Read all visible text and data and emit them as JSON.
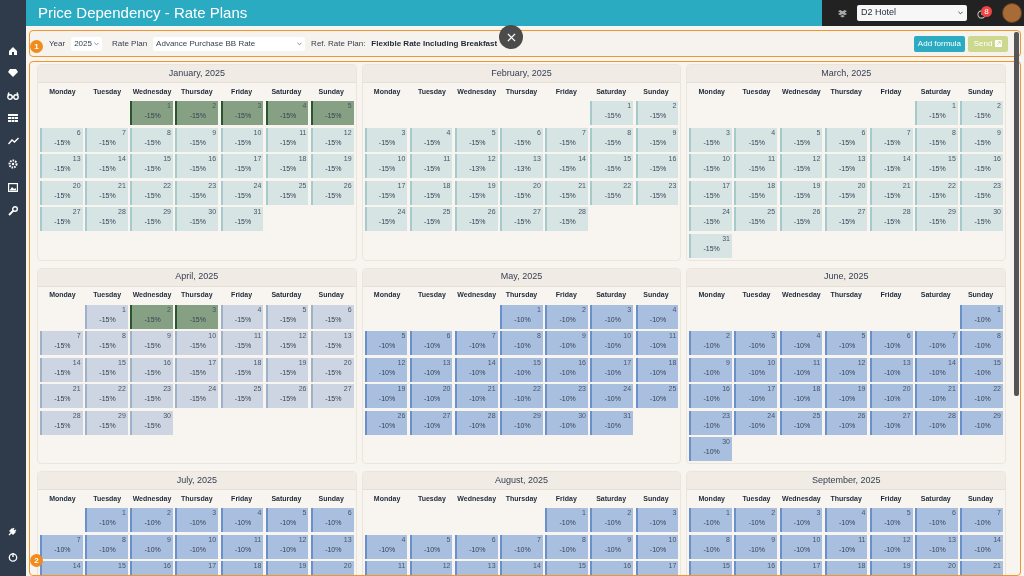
{
  "header": {
    "title": "Price Dependency - Rate Plans",
    "hotel": "D2 Hotel",
    "notification_count": "8"
  },
  "filters": {
    "year_label": "Year",
    "year": "2025",
    "rate_plan_label": "Rate Plan",
    "rate_plan": "Advance Purchase BB Rate",
    "ref_label": "Ref. Rate Plan:",
    "ref_value": "Flexible Rate Including Breakfast",
    "buttons": [
      {
        "label": "Add formula",
        "disabled": false,
        "kind": "formula"
      },
      {
        "label": "Send",
        "disabled": true,
        "kind": "send"
      }
    ]
  },
  "annotations": [
    "1",
    "2"
  ],
  "months": [
    {
      "title": "January, 2025",
      "kind": "teal",
      "weekdays": [
        "Monday",
        "Tuesday",
        "Wednesday",
        "Thursday",
        "Friday",
        "Saturday",
        "Sunday"
      ],
      "weeks": [
        [
          {
            "kind": "empty"
          },
          {
            "kind": "empty"
          },
          {
            "day": "1",
            "value": "-15%",
            "selected": true
          },
          {
            "day": "2",
            "value": "-15%",
            "selected": true
          },
          {
            "day": "3",
            "value": "-15%",
            "selected": true
          },
          {
            "day": "4",
            "value": "-15%",
            "selected": true
          },
          {
            "day": "5",
            "value": "-15%",
            "selected": true
          }
        ],
        [
          {
            "day": "6",
            "value": "-15%",
            "selected": false
          },
          {
            "day": "7",
            "value": "-15%",
            "selected": false
          },
          {
            "day": "8",
            "value": "-15%",
            "selected": false
          },
          {
            "day": "9",
            "value": "-15%",
            "selected": false
          },
          {
            "day": "10",
            "value": "-15%",
            "selected": false
          },
          {
            "day": "11",
            "value": "-15%",
            "selected": false
          },
          {
            "day": "12",
            "value": "-15%",
            "selected": false
          }
        ],
        [
          {
            "day": "13",
            "value": "-15%",
            "selected": false
          },
          {
            "day": "14",
            "value": "-15%",
            "selected": false
          },
          {
            "day": "15",
            "value": "-15%",
            "selected": false
          },
          {
            "day": "16",
            "value": "-15%",
            "selected": false
          },
          {
            "day": "17",
            "value": "-15%",
            "selected": false
          },
          {
            "day": "18",
            "value": "-15%",
            "selected": false
          },
          {
            "day": "19",
            "value": "-15%",
            "selected": false
          }
        ],
        [
          {
            "day": "20",
            "value": "-15%",
            "selected": false
          },
          {
            "day": "21",
            "value": "-15%",
            "selected": false
          },
          {
            "day": "22",
            "value": "-15%",
            "selected": false
          },
          {
            "day": "23",
            "value": "-15%",
            "selected": false
          },
          {
            "day": "24",
            "value": "-15%",
            "selected": false
          },
          {
            "day": "25",
            "value": "-15%",
            "selected": false
          },
          {
            "day": "26",
            "value": "-15%",
            "selected": false
          }
        ],
        [
          {
            "day": "27",
            "value": "-15%",
            "selected": false
          },
          {
            "day": "28",
            "value": "-15%",
            "selected": false
          },
          {
            "day": "29",
            "value": "-15%",
            "selected": false
          },
          {
            "day": "30",
            "value": "-15%",
            "selected": false
          },
          {
            "day": "31",
            "value": "-15%",
            "selected": false
          }
        ]
      ]
    },
    {
      "title": "February, 2025",
      "kind": "teal",
      "weekdays": [
        "Monday",
        "Tuesday",
        "Wednesday",
        "Thursday",
        "Friday",
        "Saturday",
        "Sunday"
      ],
      "weeks": [
        [
          {
            "kind": "empty"
          },
          {
            "kind": "empty"
          },
          {
            "kind": "empty"
          },
          {
            "kind": "empty"
          },
          {
            "kind": "empty"
          },
          {
            "day": "1",
            "value": "-15%",
            "selected": false
          },
          {
            "day": "2",
            "value": "-15%",
            "selected": false
          }
        ],
        [
          {
            "day": "3",
            "value": "-15%",
            "selected": false
          },
          {
            "day": "4",
            "value": "-15%",
            "selected": false
          },
          {
            "day": "5",
            "value": "-15%",
            "selected": false
          },
          {
            "day": "6",
            "value": "-15%",
            "selected": false
          },
          {
            "day": "7",
            "value": "-15%",
            "selected": false
          },
          {
            "day": "8",
            "value": "-15%",
            "selected": false
          },
          {
            "day": "9",
            "value": "-15%",
            "selected": false
          }
        ],
        [
          {
            "day": "10",
            "value": "-15%",
            "selected": false
          },
          {
            "day": "11",
            "value": "-15%",
            "selected": false
          },
          {
            "day": "12",
            "value": "-13%",
            "selected": false
          },
          {
            "day": "13",
            "value": "-13%",
            "selected": false
          },
          {
            "day": "14",
            "value": "-15%",
            "selected": false
          },
          {
            "day": "15",
            "value": "-15%",
            "selected": false
          },
          {
            "day": "16",
            "value": "-15%",
            "selected": false
          }
        ],
        [
          {
            "day": "17",
            "value": "-15%",
            "selected": false
          },
          {
            "day": "18",
            "value": "-15%",
            "selected": false
          },
          {
            "day": "19",
            "value": "-15%",
            "selected": false
          },
          {
            "day": "20",
            "value": "-15%",
            "selected": false
          },
          {
            "day": "21",
            "value": "-15%",
            "selected": false
          },
          {
            "day": "22",
            "value": "-15%",
            "selected": false
          },
          {
            "day": "23",
            "value": "-15%",
            "selected": false
          }
        ],
        [
          {
            "day": "24",
            "value": "-15%",
            "selected": false
          },
          {
            "day": "25",
            "value": "-15%",
            "selected": false
          },
          {
            "day": "26",
            "value": "-15%",
            "selected": false
          },
          {
            "day": "27",
            "value": "-15%",
            "selected": false
          },
          {
            "day": "28",
            "value": "-15%",
            "selected": false
          }
        ]
      ]
    },
    {
      "title": "March, 2025",
      "kind": "teal",
      "weekdays": [
        "Monday",
        "Tuesday",
        "Wednesday",
        "Thursday",
        "Friday",
        "Saturday",
        "Sunday"
      ],
      "weeks": [
        [
          {
            "kind": "empty"
          },
          {
            "kind": "empty"
          },
          {
            "kind": "empty"
          },
          {
            "kind": "empty"
          },
          {
            "kind": "empty"
          },
          {
            "day": "1",
            "value": "-15%",
            "selected": false
          },
          {
            "day": "2",
            "value": "-15%",
            "selected": false
          }
        ],
        [
          {
            "day": "3",
            "value": "-15%",
            "selected": false
          },
          {
            "day": "4",
            "value": "-15%",
            "selected": false
          },
          {
            "day": "5",
            "value": "-15%",
            "selected": false
          },
          {
            "day": "6",
            "value": "-15%",
            "selected": false
          },
          {
            "day": "7",
            "value": "-15%",
            "selected": false
          },
          {
            "day": "8",
            "value": "-15%",
            "selected": false
          },
          {
            "day": "9",
            "value": "-15%",
            "selected": false
          }
        ],
        [
          {
            "day": "10",
            "value": "-15%",
            "selected": false
          },
          {
            "day": "11",
            "value": "-15%",
            "selected": false
          },
          {
            "day": "12",
            "value": "-15%",
            "selected": false
          },
          {
            "day": "13",
            "value": "-15%",
            "selected": false
          },
          {
            "day": "14",
            "value": "-15%",
            "selected": false
          },
          {
            "day": "15",
            "value": "-15%",
            "selected": false
          },
          {
            "day": "16",
            "value": "-15%",
            "selected": false
          }
        ],
        [
          {
            "day": "17",
            "value": "-15%",
            "selected": false
          },
          {
            "day": "18",
            "value": "-15%",
            "selected": false
          },
          {
            "day": "19",
            "value": "-15%",
            "selected": false
          },
          {
            "day": "20",
            "value": "-15%",
            "selected": false
          },
          {
            "day": "21",
            "value": "-15%",
            "selected": false
          },
          {
            "day": "22",
            "value": "-15%",
            "selected": false
          },
          {
            "day": "23",
            "value": "-15%",
            "selected": false
          }
        ],
        [
          {
            "day": "24",
            "value": "-15%",
            "selected": false
          },
          {
            "day": "25",
            "value": "-15%",
            "selected": false
          },
          {
            "day": "26",
            "value": "-15%",
            "selected": false
          },
          {
            "day": "27",
            "value": "-15%",
            "selected": false
          },
          {
            "day": "28",
            "value": "-15%",
            "selected": false
          },
          {
            "day": "29",
            "value": "-15%",
            "selected": false
          },
          {
            "day": "30",
            "value": "-15%",
            "selected": false
          }
        ],
        [
          {
            "day": "31",
            "value": "-15%",
            "selected": false
          }
        ]
      ]
    },
    {
      "title": "April, 2025",
      "kind": "slate",
      "weekdays": [
        "Monday",
        "Tuesday",
        "Wednesday",
        "Thursday",
        "Friday",
        "Saturday",
        "Sunday"
      ],
      "weeks": [
        [
          {
            "kind": "empty"
          },
          {
            "day": "1",
            "value": "-15%",
            "selected": false
          },
          {
            "day": "2",
            "value": "-15%",
            "selected": true
          },
          {
            "day": "3",
            "value": "-15%",
            "selected": true
          },
          {
            "day": "4",
            "value": "-15%",
            "selected": false
          },
          {
            "day": "5",
            "value": "-15%",
            "selected": false
          },
          {
            "day": "6",
            "value": "-15%",
            "selected": false
          }
        ],
        [
          {
            "day": "7",
            "value": "-15%",
            "selected": false
          },
          {
            "day": "8",
            "value": "-15%",
            "selected": false
          },
          {
            "day": "9",
            "value": "-15%",
            "selected": false
          },
          {
            "day": "10",
            "value": "-15%",
            "selected": false
          },
          {
            "day": "11",
            "value": "-15%",
            "selected": false
          },
          {
            "day": "12",
            "value": "-15%",
            "selected": false
          },
          {
            "day": "13",
            "value": "-15%",
            "selected": false
          }
        ],
        [
          {
            "day": "14",
            "value": "-15%",
            "selected": false
          },
          {
            "day": "15",
            "value": "-15%",
            "selected": false
          },
          {
            "day": "16",
            "value": "-15%",
            "selected": false
          },
          {
            "day": "17",
            "value": "-15%",
            "selected": false
          },
          {
            "day": "18",
            "value": "-15%",
            "selected": false
          },
          {
            "day": "19",
            "value": "-15%",
            "selected": false
          },
          {
            "day": "20",
            "value": "-15%",
            "selected": false
          }
        ],
        [
          {
            "day": "21",
            "value": "-15%",
            "selected": false
          },
          {
            "day": "22",
            "value": "-15%",
            "selected": false
          },
          {
            "day": "23",
            "value": "-15%",
            "selected": false
          },
          {
            "day": "24",
            "value": "-15%",
            "selected": false
          },
          {
            "day": "25",
            "value": "-15%",
            "selected": false
          },
          {
            "day": "26",
            "value": "-15%",
            "selected": false
          },
          {
            "day": "27",
            "value": "-15%",
            "selected": false
          }
        ],
        [
          {
            "day": "28",
            "value": "-15%",
            "selected": false
          },
          {
            "day": "29",
            "value": "-15%",
            "selected": false
          },
          {
            "day": "30",
            "value": "-15%",
            "selected": false
          }
        ]
      ]
    },
    {
      "title": "May, 2025",
      "kind": "blue",
      "weekdays": [
        "Monday",
        "Tuesday",
        "Wednesday",
        "Thursday",
        "Friday",
        "Saturday",
        "Sunday"
      ],
      "weeks": [
        [
          {
            "kind": "empty"
          },
          {
            "kind": "empty"
          },
          {
            "kind": "empty"
          },
          {
            "day": "1",
            "value": "-10%",
            "selected": false
          },
          {
            "day": "2",
            "value": "-10%",
            "selected": false
          },
          {
            "day": "3",
            "value": "-10%",
            "selected": false
          },
          {
            "day": "4",
            "value": "-10%",
            "selected": false
          }
        ],
        [
          {
            "day": "5",
            "value": "-10%",
            "selected": false
          },
          {
            "day": "6",
            "value": "-10%",
            "selected": false
          },
          {
            "day": "7",
            "value": "-10%",
            "selected": false
          },
          {
            "day": "8",
            "value": "-10%",
            "selected": false
          },
          {
            "day": "9",
            "value": "-10%",
            "selected": false
          },
          {
            "day": "10",
            "value": "-10%",
            "selected": false
          },
          {
            "day": "11",
            "value": "-10%",
            "selected": false
          }
        ],
        [
          {
            "day": "12",
            "value": "-10%",
            "selected": false
          },
          {
            "day": "13",
            "value": "-10%",
            "selected": false
          },
          {
            "day": "14",
            "value": "-10%",
            "selected": false
          },
          {
            "day": "15",
            "value": "-10%",
            "selected": false
          },
          {
            "day": "16",
            "value": "-10%",
            "selected": false
          },
          {
            "day": "17",
            "value": "-10%",
            "selected": false
          },
          {
            "day": "18",
            "value": "-10%",
            "selected": false
          }
        ],
        [
          {
            "day": "19",
            "value": "-10%",
            "selected": false
          },
          {
            "day": "20",
            "value": "-10%",
            "selected": false
          },
          {
            "day": "21",
            "value": "-10%",
            "selected": false
          },
          {
            "day": "22",
            "value": "-10%",
            "selected": false
          },
          {
            "day": "23",
            "value": "-10%",
            "selected": false
          },
          {
            "day": "24",
            "value": "-10%",
            "selected": false
          },
          {
            "day": "25",
            "value": "-10%",
            "selected": false
          }
        ],
        [
          {
            "day": "26",
            "value": "-10%",
            "selected": false
          },
          {
            "day": "27",
            "value": "-10%",
            "selected": false
          },
          {
            "day": "28",
            "value": "-10%",
            "selected": false
          },
          {
            "day": "29",
            "value": "-10%",
            "selected": false
          },
          {
            "day": "30",
            "value": "-10%",
            "selected": false
          },
          {
            "day": "31",
            "value": "-10%",
            "selected": false
          }
        ]
      ]
    },
    {
      "title": "June, 2025",
      "kind": "blue",
      "weekdays": [
        "Monday",
        "Tuesday",
        "Wednesday",
        "Thursday",
        "Friday",
        "Saturday",
        "Sunday"
      ],
      "weeks": [
        [
          {
            "kind": "empty"
          },
          {
            "kind": "empty"
          },
          {
            "kind": "empty"
          },
          {
            "kind": "empty"
          },
          {
            "kind": "empty"
          },
          {
            "kind": "empty"
          },
          {
            "day": "1",
            "value": "-10%",
            "selected": false
          }
        ],
        [
          {
            "day": "2",
            "value": "-10%",
            "selected": false
          },
          {
            "day": "3",
            "value": "-10%",
            "selected": false
          },
          {
            "day": "4",
            "value": "-10%",
            "selected": false
          },
          {
            "day": "5",
            "value": "-10%",
            "selected": false
          },
          {
            "day": "6",
            "value": "-10%",
            "selected": false
          },
          {
            "day": "7",
            "value": "-10%",
            "selected": false
          },
          {
            "day": "8",
            "value": "-10%",
            "selected": false
          }
        ],
        [
          {
            "day": "9",
            "value": "-10%",
            "selected": false
          },
          {
            "day": "10",
            "value": "-10%",
            "selected": false
          },
          {
            "day": "11",
            "value": "-10%",
            "selected": false
          },
          {
            "day": "12",
            "value": "-10%",
            "selected": false
          },
          {
            "day": "13",
            "value": "-10%",
            "selected": false
          },
          {
            "day": "14",
            "value": "-10%",
            "selected": false
          },
          {
            "day": "15",
            "value": "-10%",
            "selected": false
          }
        ],
        [
          {
            "day": "16",
            "value": "-10%",
            "selected": false
          },
          {
            "day": "17",
            "value": "-10%",
            "selected": false
          },
          {
            "day": "18",
            "value": "-10%",
            "selected": false
          },
          {
            "day": "19",
            "value": "-10%",
            "selected": false
          },
          {
            "day": "20",
            "value": "-10%",
            "selected": false
          },
          {
            "day": "21",
            "value": "-10%",
            "selected": false
          },
          {
            "day": "22",
            "value": "-10%",
            "selected": false
          }
        ],
        [
          {
            "day": "23",
            "value": "-10%",
            "selected": false
          },
          {
            "day": "24",
            "value": "-10%",
            "selected": false
          },
          {
            "day": "25",
            "value": "-10%",
            "selected": false
          },
          {
            "day": "26",
            "value": "-10%",
            "selected": false
          },
          {
            "day": "27",
            "value": "-10%",
            "selected": false
          },
          {
            "day": "28",
            "value": "-10%",
            "selected": false
          },
          {
            "day": "29",
            "value": "-10%",
            "selected": false
          }
        ],
        [
          {
            "day": "30",
            "value": "-10%",
            "selected": false
          }
        ]
      ]
    },
    {
      "title": "July, 2025",
      "kind": "blue",
      "weekdays": [
        "Monday",
        "Tuesday",
        "Wednesday",
        "Thursday",
        "Friday",
        "Saturday",
        "Sunday"
      ],
      "weeks": [
        [
          {
            "kind": "empty"
          },
          {
            "day": "1",
            "value": "-10%",
            "selected": false
          },
          {
            "day": "2",
            "value": "-10%",
            "selected": false
          },
          {
            "day": "3",
            "value": "-10%",
            "selected": false
          },
          {
            "day": "4",
            "value": "-10%",
            "selected": false
          },
          {
            "day": "5",
            "value": "-10%",
            "selected": false
          },
          {
            "day": "6",
            "value": "-10%",
            "selected": false
          }
        ],
        [
          {
            "day": "7",
            "value": "-10%",
            "selected": false
          },
          {
            "day": "8",
            "value": "-10%",
            "selected": false
          },
          {
            "day": "9",
            "value": "-10%",
            "selected": false
          },
          {
            "day": "10",
            "value": "-10%",
            "selected": false
          },
          {
            "day": "11",
            "value": "-10%",
            "selected": false
          },
          {
            "day": "12",
            "value": "-10%",
            "selected": false
          },
          {
            "day": "13",
            "value": "-10%",
            "selected": false
          }
        ],
        [
          {
            "day": "14",
            "selected": false
          },
          {
            "day": "15",
            "selected": false
          },
          {
            "day": "16",
            "selected": false
          },
          {
            "day": "17",
            "selected": false
          },
          {
            "day": "18",
            "selected": false
          },
          {
            "day": "19",
            "selected": false
          },
          {
            "day": "20",
            "selected": false
          }
        ]
      ]
    },
    {
      "title": "August, 2025",
      "kind": "blue",
      "weekdays": [
        "Monday",
        "Tuesday",
        "Wednesday",
        "Thursday",
        "Friday",
        "Saturday",
        "Sunday"
      ],
      "weeks": [
        [
          {
            "kind": "empty"
          },
          {
            "kind": "empty"
          },
          {
            "kind": "empty"
          },
          {
            "kind": "empty"
          },
          {
            "day": "1",
            "value": "-10%",
            "selected": false
          },
          {
            "day": "2",
            "value": "-10%",
            "selected": false
          },
          {
            "day": "3",
            "value": "-10%",
            "selected": false
          }
        ],
        [
          {
            "day": "4",
            "value": "-10%",
            "selected": false
          },
          {
            "day": "5",
            "value": "-10%",
            "selected": false
          },
          {
            "day": "6",
            "value": "-10%",
            "selected": false
          },
          {
            "day": "7",
            "value": "-10%",
            "selected": false
          },
          {
            "day": "8",
            "value": "-10%",
            "selected": false
          },
          {
            "day": "9",
            "value": "-10%",
            "selected": false
          },
          {
            "day": "10",
            "value": "-10%",
            "selected": false
          }
        ],
        [
          {
            "day": "11",
            "selected": false
          },
          {
            "day": "12",
            "selected": false
          },
          {
            "day": "13",
            "selected": false
          },
          {
            "day": "14",
            "selected": false
          },
          {
            "day": "15",
            "selected": false
          },
          {
            "day": "16",
            "selected": false
          },
          {
            "day": "17",
            "selected": false
          }
        ]
      ]
    },
    {
      "title": "September, 2025",
      "kind": "blue",
      "weekdays": [
        "Monday",
        "Tuesday",
        "Wednesday",
        "Thursday",
        "Friday",
        "Saturday",
        "Sunday"
      ],
      "weeks": [
        [
          {
            "day": "1",
            "value": "-10%",
            "selected": false
          },
          {
            "day": "2",
            "value": "-10%",
            "selected": false
          },
          {
            "day": "3",
            "value": "-10%",
            "selected": false
          },
          {
            "day": "4",
            "value": "-10%",
            "selected": false
          },
          {
            "day": "5",
            "value": "-10%",
            "selected": false
          },
          {
            "day": "6",
            "value": "-10%",
            "selected": false
          },
          {
            "day": "7",
            "value": "-10%",
            "selected": false
          }
        ],
        [
          {
            "day": "8",
            "value": "-10%",
            "selected": false
          },
          {
            "day": "9",
            "value": "-10%",
            "selected": false
          },
          {
            "day": "10",
            "value": "-10%",
            "selected": false
          },
          {
            "day": "11",
            "value": "-10%",
            "selected": false
          },
          {
            "day": "12",
            "value": "-10%",
            "selected": false
          },
          {
            "day": "13",
            "value": "-10%",
            "selected": false
          },
          {
            "day": "14",
            "value": "-10%",
            "selected": false
          }
        ],
        [
          {
            "day": "15",
            "selected": false
          },
          {
            "day": "16",
            "selected": false
          },
          {
            "day": "17",
            "selected": false
          },
          {
            "day": "18",
            "selected": false
          },
          {
            "day": "19",
            "selected": false
          },
          {
            "day": "20",
            "selected": false
          },
          {
            "day": "21",
            "selected": false
          }
        ]
      ]
    }
  ]
}
